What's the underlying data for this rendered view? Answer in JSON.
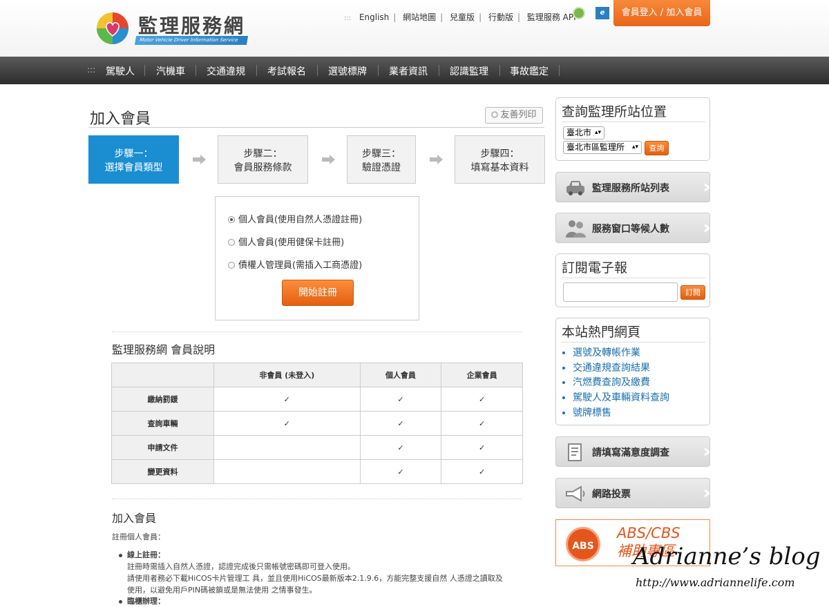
{
  "header": {
    "logo_text": "監理服務網",
    "logo_subtext": "Motor Vehicle Driver Information Service",
    "top_links": [
      "English",
      "網站地圖",
      "兒童版",
      "行動版",
      "監理服務 APP"
    ],
    "top_dots": ":::",
    "login_button": "會員登入 / 加入會員"
  },
  "nav": {
    "dots": ":::",
    "items": [
      "駕駛人",
      "汽機車",
      "交通違規",
      "考試報名",
      "選號標牌",
      "業者資訊",
      "認識監理",
      "事故鑑定"
    ]
  },
  "page": {
    "title": "加入會員",
    "print_button": "友善列印"
  },
  "steps": [
    {
      "line1": "步驟一：",
      "line2": "選擇會員類型"
    },
    {
      "line1": "步驟二：",
      "line2": "會員服務條款"
    },
    {
      "line1": "步驟三：",
      "line2": "驗證憑證"
    },
    {
      "line1": "步驟四：",
      "line2": "填寫基本資料"
    }
  ],
  "register": {
    "options": [
      {
        "label": "個人會員(使用自然人憑證註冊)",
        "checked": true
      },
      {
        "label": "個人會員(使用健保卡註冊)",
        "checked": false
      },
      {
        "label": "債權人管理員(需插入工商憑證)",
        "checked": false
      }
    ],
    "start_button": "開始註冊"
  },
  "member_info": {
    "title": "監理服務網 會員說明",
    "columns": [
      "",
      "非會員 (未登入)",
      "個人會員",
      "企業會員"
    ],
    "rows": [
      {
        "label": "繳納罰鍰",
        "cells": [
          "✓",
          "✓",
          "✓"
        ]
      },
      {
        "label": "查詢車輛",
        "cells": [
          "✓",
          "✓",
          "✓"
        ]
      },
      {
        "label": "申請文件",
        "cells": [
          "",
          "✓",
          "✓"
        ]
      },
      {
        "label": "變更資料",
        "cells": [
          "",
          "✓",
          "✓"
        ]
      }
    ]
  },
  "join": {
    "title": "加入會員",
    "intro": "註冊個人會員：",
    "online_title": "線上註冊：",
    "online_lines": [
      "註冊時需插入自然人憑證，認證完成後只需帳號密碼即可登入使用。",
      "請使用者務必下載HiCOS卡片管理工 具，並且使用HiCOS最新版本2.1.9.6，方能完整支援自然 人憑證之讀取及",
      "使用，以避免用戶PIN碼被鎖或是無法使用 之情事發生。"
    ],
    "counter_title": "臨櫃辦理："
  },
  "sidebar": {
    "station_query": {
      "title": "查詢監理所站位置",
      "city": "臺北市",
      "office": "臺北市區監理所",
      "button": "查詢"
    },
    "station_list": "監理服務所站列表",
    "wait_count": "服務窗口等候人數",
    "newsletter": {
      "title": "訂閱電子報",
      "placeholder": "",
      "button": "訂閱"
    },
    "hot_pages": {
      "title": "本站熱門網頁",
      "items": [
        "選號及轉帳作業",
        "交通違規查詢結果",
        "汽燃費查詢及繳費",
        "駕駛人及車輛資料查詢",
        "號牌標售"
      ]
    },
    "survey": "請填寫滿意度調查",
    "vote": "網路投票",
    "abs": {
      "badge": "ABS",
      "line1": "ABS/CBS",
      "line2": "補助專區"
    }
  },
  "watermark": {
    "blog": "Adrianne’s blog",
    "url": "http://www.adriannelife.com"
  },
  "colors": {
    "accent_orange": "#e9661a",
    "active_step_blue": "#1a8ed1",
    "link_blue": "#1a6faf"
  }
}
